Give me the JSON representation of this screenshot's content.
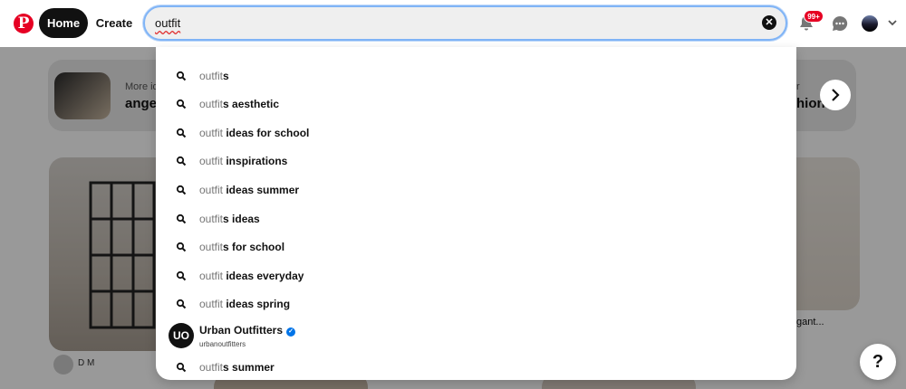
{
  "header": {
    "logo": "P",
    "home_label": "Home",
    "create_label": "Create",
    "search_value": "outfit",
    "notification_badge": "99+",
    "icons": {
      "logo": "pinterest-logo",
      "clear": "clear-search-icon",
      "notifications": "bell-icon",
      "messages": "chat-icon",
      "account": "chevron-down-icon"
    }
  },
  "suggestions": [
    {
      "typed": "outfit",
      "rest": "s"
    },
    {
      "typed": "outfit",
      "rest": "s aesthetic"
    },
    {
      "typed": "outfit",
      "rest": " ideas for school"
    },
    {
      "typed": "outfit",
      "rest": " inspirations"
    },
    {
      "typed": "outfit",
      "rest": " ideas summer"
    },
    {
      "typed": "outfit",
      "rest": "s ideas"
    },
    {
      "typed": "outfit",
      "rest": "s for school"
    },
    {
      "typed": "outfit",
      "rest": " ideas everyday"
    },
    {
      "typed": "outfit",
      "rest": " ideas spring"
    }
  ],
  "profile_suggestion": {
    "logo": "UO",
    "name": "Urban Outfitters",
    "handle": "urbanoutfitters",
    "verified": "✓"
  },
  "last_suggestion": {
    "typed": "outfit",
    "rest": "s summer"
  },
  "background": {
    "banner_left_small": "More id",
    "banner_left_big": "ange",
    "banner_right_small": "r",
    "banner_right_big": "hion",
    "pin_right_caption": "gant...",
    "pin_left_user": "D M"
  },
  "help_label": "?",
  "colors": {
    "brand": "#e60023",
    "dark": "#111111",
    "focus": "#80b4f6",
    "verified": "#0074e8"
  }
}
